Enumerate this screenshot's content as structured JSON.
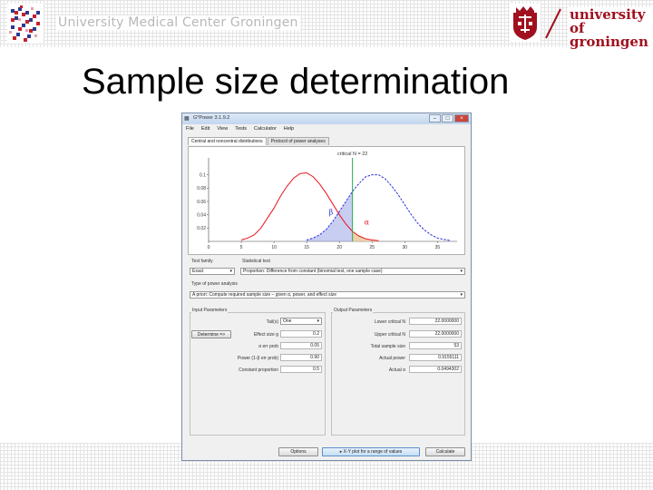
{
  "header": {
    "org_name": "University Medical Center Groningen",
    "university_line1": "university of",
    "university_line2": "groningen"
  },
  "slide": {
    "title": "Sample size determination"
  },
  "window": {
    "title": "G*Power 3.1.9.2",
    "min_glyph": "–",
    "max_glyph": "□",
    "close_glyph": "×",
    "menu": [
      "File",
      "Edit",
      "View",
      "Tests",
      "Calculator",
      "Help"
    ],
    "tabs": [
      "Central and noncentral distributions",
      "Protocol of power analyses"
    ]
  },
  "chart_data": {
    "type": "line",
    "title": "critical N = 22",
    "x_ticks": [
      0,
      5,
      10,
      15,
      20,
      25,
      30,
      35
    ],
    "y_ticks": [
      0.1,
      0.08,
      0.06,
      0.04,
      0.02
    ],
    "xlim": [
      0,
      38
    ],
    "ylim": [
      0,
      0.12
    ],
    "critical_x": 22,
    "beta_label": "β",
    "alpha_label": "α",
    "series": [
      {
        "color": "#e8141b",
        "style": "solid",
        "x": [
          5,
          6,
          7,
          8,
          9,
          10,
          11,
          12,
          13,
          14,
          15,
          16,
          17,
          18,
          19,
          20,
          21,
          22,
          23,
          24,
          25,
          26
        ],
        "values": [
          0.002,
          0.005,
          0.01,
          0.02,
          0.035,
          0.05,
          0.068,
          0.083,
          0.095,
          0.102,
          0.103,
          0.097,
          0.086,
          0.072,
          0.056,
          0.04,
          0.026,
          0.015,
          0.008,
          0.004,
          0.002,
          0.001
        ]
      },
      {
        "color": "#2a2fd9",
        "style": "dashed",
        "x": [
          15,
          16,
          17,
          18,
          19,
          20,
          21,
          22,
          23,
          24,
          25,
          26,
          27,
          28,
          29,
          30,
          31,
          32,
          33,
          34,
          35,
          36,
          37
        ],
        "values": [
          0.002,
          0.005,
          0.01,
          0.018,
          0.03,
          0.045,
          0.06,
          0.075,
          0.087,
          0.097,
          0.1,
          0.1,
          0.094,
          0.083,
          0.07,
          0.055,
          0.04,
          0.027,
          0.017,
          0.01,
          0.005,
          0.003,
          0.001
        ]
      }
    ]
  },
  "form": {
    "test_family_label": "Test family",
    "test_family": "Exact",
    "statistical_test_label": "Statistical test",
    "statistical_test": "Proportion: Difference from constant (binomial test, one sample case)",
    "power_type_label": "Type of power analysis",
    "power_type": "A priori: Compute required sample size – given α, power, and effect size",
    "input_title": "Input Parameters",
    "output_title": "Output Parameters",
    "determine_label": "Determine =>",
    "inputs": [
      {
        "name": "Tail(s)",
        "value": "One",
        "dropdown": true
      },
      {
        "name": "Effect size g",
        "value": "0.2"
      },
      {
        "name": "α err prob",
        "value": "0.05"
      },
      {
        "name": "Power (1-β err prob)",
        "value": "0.90"
      },
      {
        "name": "Constant proportion",
        "value": "0.5"
      }
    ],
    "outputs": [
      {
        "name": "Lower critical N",
        "value": "22.0000000"
      },
      {
        "name": "Upper critical N",
        "value": "22.0000000"
      },
      {
        "name": "Total sample size",
        "value": "53"
      },
      {
        "name": "Actual power",
        "value": "0.9155111"
      },
      {
        "name": "Actual α",
        "value": "0.0494302"
      }
    ]
  },
  "buttons": {
    "options": "Options",
    "xy_plot": "X-Y plot for a range of values",
    "calculate": "Calculate"
  }
}
